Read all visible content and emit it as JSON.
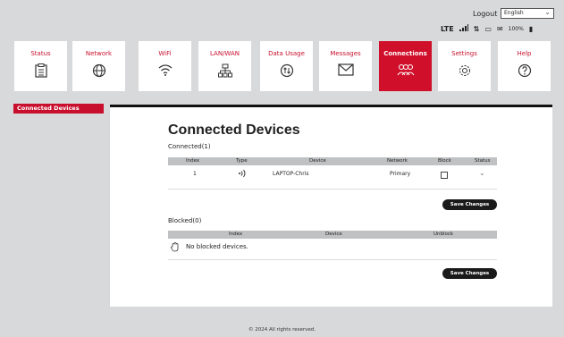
{
  "header": {
    "logout_label": "Logout",
    "language": "English",
    "status": {
      "network_type": "LTE",
      "signal": "▐▐",
      "data_arrows": "⇅",
      "battery": "100%"
    }
  },
  "nav": [
    {
      "label": "Status"
    },
    {
      "label": "Network"
    },
    {
      "label": "WiFi"
    },
    {
      "label": "LAN/WAN"
    },
    {
      "label": "Data Usage"
    },
    {
      "label": "Messages"
    },
    {
      "label": "Connections"
    },
    {
      "label": "Settings"
    },
    {
      "label": "Help"
    }
  ],
  "sidebar": {
    "items": [
      {
        "label": "Connected Devices"
      }
    ]
  },
  "page": {
    "title": "Connected Devices",
    "connected_heading": "Connected(1)",
    "connected_columns": [
      "Index",
      "Type",
      "Device",
      "Network",
      "Block",
      "Status"
    ],
    "connected_rows": [
      {
        "index": "1",
        "type_icon": "wifi-icon",
        "device": "LAPTOP-Chris",
        "network": "Primary",
        "block": false,
        "status_icon": "chevron-down-icon"
      }
    ],
    "save_label": "Save Changes",
    "blocked_heading": "Blocked(0)",
    "blocked_columns": [
      "Index",
      "Device",
      "Unblock"
    ],
    "blocked_empty": "No blocked devices.",
    "save_label_2": "Save Changes"
  },
  "footer": {
    "text": "© 2024 All rights reserved."
  },
  "colors": {
    "accent": "#c8102e",
    "active_tab": "#d0102b",
    "button": "#1a1a1a"
  }
}
